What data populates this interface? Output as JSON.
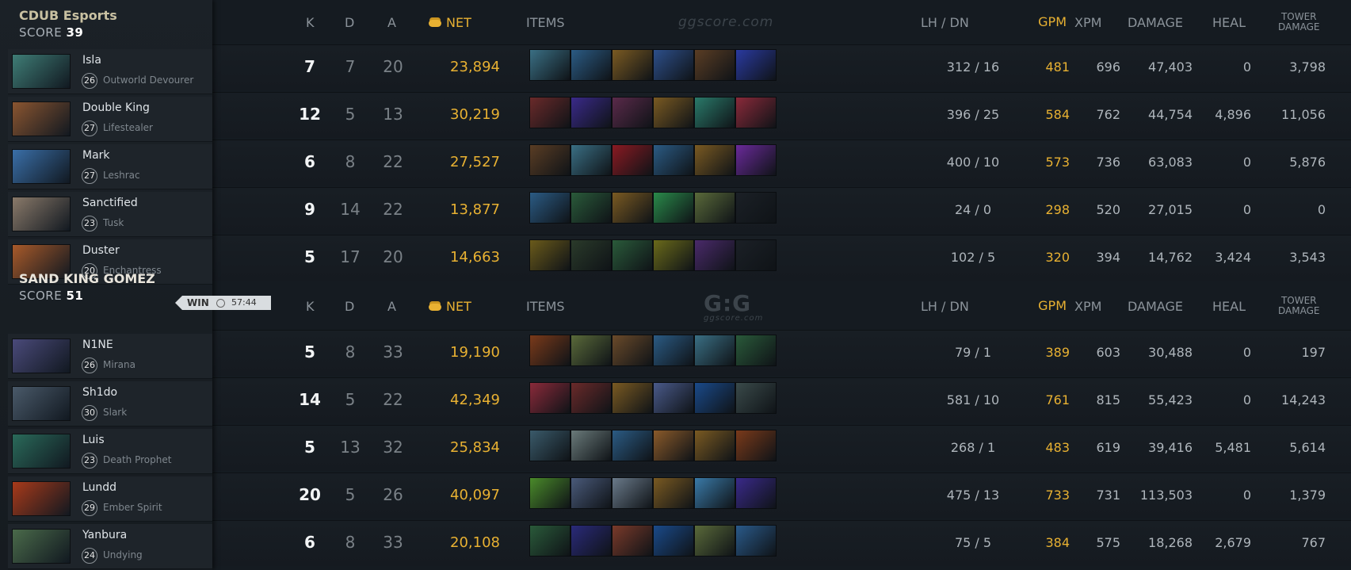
{
  "teams": [
    {
      "name": "CDUB Esports",
      "score_label": "SCORE",
      "score": "39",
      "players": [
        {
          "name": "Isla",
          "level": "26",
          "hero": "Outworld Devourer",
          "color": "#3f7d76",
          "k": "7",
          "d": "7",
          "a": "20",
          "net": "23,894",
          "lh": "312",
          "dn": "16",
          "gpm": "481",
          "xpm": "696",
          "damage": "47,403",
          "heal": "0",
          "tower": "3,798",
          "items": [
            "#3a6f84",
            "#2b5b84",
            "#7a5a22",
            "#2d4f8a",
            "#5a3d24",
            "#2a3aa0"
          ]
        },
        {
          "name": "Double King",
          "level": "27",
          "hero": "Lifestealer",
          "color": "#8a5530",
          "k": "12",
          "d": "5",
          "a": "13",
          "net": "30,219",
          "lh": "396",
          "dn": "25",
          "gpm": "584",
          "xpm": "762",
          "damage": "44,754",
          "heal": "4,896",
          "tower": "11,056",
          "items": [
            "#6a2a2a",
            "#3a2a8a",
            "#5a2a4a",
            "#7a5a22",
            "#2a7a6a",
            "#8a2a3a"
          ]
        },
        {
          "name": "Mark",
          "level": "27",
          "hero": "Leshrac",
          "color": "#3a6fa8",
          "k": "6",
          "d": "8",
          "a": "22",
          "net": "27,527",
          "lh": "400",
          "dn": "10",
          "gpm": "573",
          "xpm": "736",
          "damage": "63,083",
          "heal": "0",
          "tower": "5,876",
          "items": [
            "#5a3d24",
            "#3a6f84",
            "#8a1a22",
            "#2b5b84",
            "#7a5a22",
            "#6a2a9a"
          ]
        },
        {
          "name": "Sanctified",
          "level": "23",
          "hero": "Tusk",
          "color": "#8a7a6a",
          "k": "9",
          "d": "14",
          "a": "22",
          "net": "13,877",
          "lh": "24",
          "dn": "0",
          "gpm": "298",
          "xpm": "520",
          "damage": "27,015",
          "heal": "0",
          "tower": "0",
          "items": [
            "#2b5b84",
            "#2a5a3a",
            "#7a5a22",
            "#2a8a4a",
            "#5a6a3a",
            "#1b2026"
          ]
        },
        {
          "name": "Duster",
          "level": "20",
          "hero": "Enchantress",
          "color": "#a85a2a",
          "k": "5",
          "d": "17",
          "a": "20",
          "net": "14,663",
          "lh": "102",
          "dn": "5",
          "gpm": "320",
          "xpm": "394",
          "damage": "14,762",
          "heal": "3,424",
          "tower": "3,543",
          "items": [
            "#6a5a1a",
            "#2a3a2a",
            "#2a5a3a",
            "#6a6a1a",
            "#4a2a6a",
            "#1b2026"
          ]
        }
      ]
    },
    {
      "name": "SAND KING GOMEZ",
      "score_label": "SCORE",
      "score": "51",
      "players": [
        {
          "name": "N1NE",
          "level": "26",
          "hero": "Mirana",
          "color": "#4a4a7a",
          "k": "5",
          "d": "8",
          "a": "33",
          "net": "19,190",
          "lh": "79",
          "dn": "1",
          "gpm": "389",
          "xpm": "603",
          "damage": "30,488",
          "heal": "0",
          "tower": "197",
          "items": [
            "#7a3a1a",
            "#5a6a3a",
            "#6a4a2a",
            "#2b5b84",
            "#3a6f84",
            "#2a5a3a"
          ]
        },
        {
          "name": "Sh1do",
          "level": "30",
          "hero": "Slark",
          "color": "#4a5a6a",
          "k": "14",
          "d": "5",
          "a": "22",
          "net": "42,349",
          "lh": "581",
          "dn": "10",
          "gpm": "761",
          "xpm": "815",
          "damage": "55,423",
          "heal": "0",
          "tower": "14,243",
          "items": [
            "#8a2a3a",
            "#6a2a2a",
            "#7a5a22",
            "#4a5a8a",
            "#1a4a8a",
            "#3a4a4a"
          ]
        },
        {
          "name": "Luis",
          "level": "23",
          "hero": "Death Prophet",
          "color": "#2a6a5a",
          "k": "5",
          "d": "13",
          "a": "32",
          "net": "25,834",
          "lh": "268",
          "dn": "1",
          "gpm": "483",
          "xpm": "619",
          "damage": "39,416",
          "heal": "5,481",
          "tower": "5,614",
          "items": [
            "#3a5a6a",
            "#6a7a7a",
            "#2b5b84",
            "#8a5a2a",
            "#7a5a22",
            "#7a3a1a"
          ]
        },
        {
          "name": "Lundd",
          "level": "29",
          "hero": "Ember Spirit",
          "color": "#a83a1a",
          "k": "20",
          "d": "5",
          "a": "26",
          "net": "40,097",
          "lh": "475",
          "dn": "13",
          "gpm": "733",
          "xpm": "731",
          "damage": "113,503",
          "heal": "0",
          "tower": "1,379",
          "items": [
            "#4a8a2a",
            "#4a5a7a",
            "#6a7a8a",
            "#7a5a22",
            "#3a7aa8",
            "#3a2a8a"
          ]
        },
        {
          "name": "Yanbura",
          "level": "24",
          "hero": "Undying",
          "color": "#4a6a4a",
          "k": "6",
          "d": "8",
          "a": "33",
          "net": "20,108",
          "lh": "75",
          "dn": "5",
          "gpm": "384",
          "xpm": "575",
          "damage": "18,268",
          "heal": "2,679",
          "tower": "767",
          "items": [
            "#2a5a3a",
            "#2a2a7a",
            "#7a3a2a",
            "#1a4a8a",
            "#5a6a3a",
            "#2a5a8a"
          ]
        }
      ]
    }
  ],
  "columns": {
    "k": "K",
    "d": "D",
    "a": "A",
    "net": "NET",
    "items": "ITEMS",
    "lhdn": "LH  /  DN",
    "gpm": "GPM",
    "xpm": "XPM",
    "damage": "DAMAGE",
    "heal": "HEAL",
    "tower_line1": "TOWER",
    "tower_line2": "DAMAGE"
  },
  "watermark": {
    "top": "ggscore.com",
    "logo": "G:G",
    "logo_sub": "ggscore.com"
  },
  "result": {
    "label": "WIN",
    "time": "57:44"
  },
  "colors": {
    "gold": "#e8b132",
    "bg": "#151b21"
  }
}
